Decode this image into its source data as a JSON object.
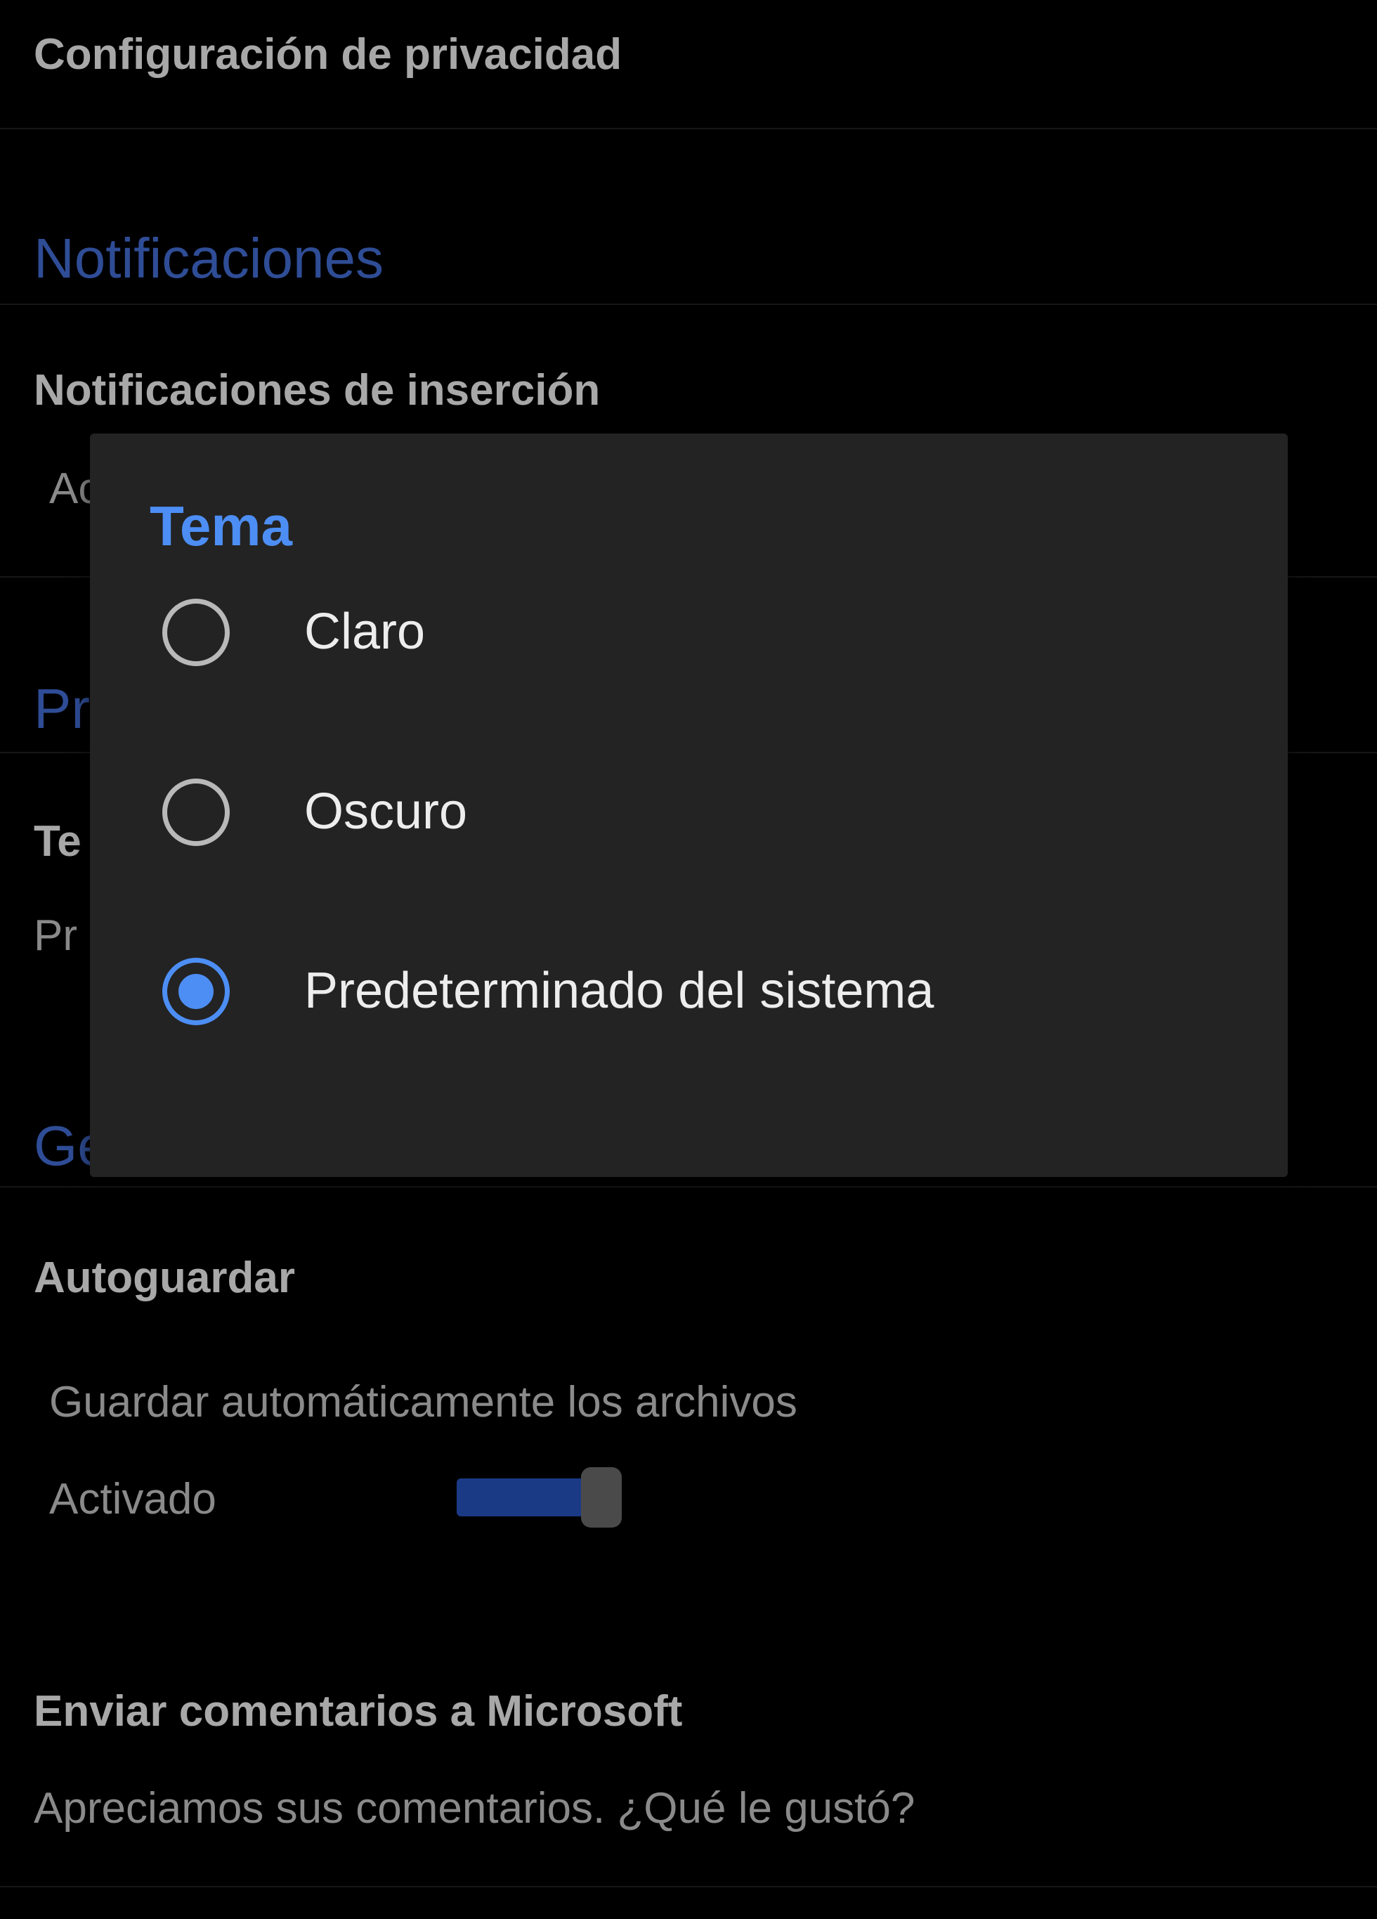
{
  "settings": {
    "privacy_settings_title": "Configuración de privacidad",
    "notifications_header": "Notificaciones",
    "push_notifications_title": "Notificaciones de inserción",
    "push_notifications_summary_partial": "Ac",
    "preferences_header_partial": "Pr",
    "theme_title_partial": "Te",
    "theme_summary_partial": "Pr",
    "general_header_partial": "Ge",
    "autosave_title": "Autoguardar",
    "autosave_description": "Guardar automáticamente los archivos",
    "autosave_state": "Activado",
    "autosave_enabled": true,
    "feedback_title": "Enviar comentarios a Microsoft",
    "feedback_summary": "Apreciamos sus comentarios. ¿Qué le gustó?"
  },
  "theme_dialog": {
    "title": "Tema",
    "options": [
      {
        "label": "Claro",
        "selected": false
      },
      {
        "label": "Oscuro",
        "selected": false
      },
      {
        "label": "Predeterminado del sistema",
        "selected": true
      }
    ]
  },
  "colors": {
    "background": "#000000",
    "dialog_background": "#232323",
    "accent": "#4d8ef5",
    "section_header": "#2f4d96",
    "toggle_track": "#1b3a86"
  }
}
